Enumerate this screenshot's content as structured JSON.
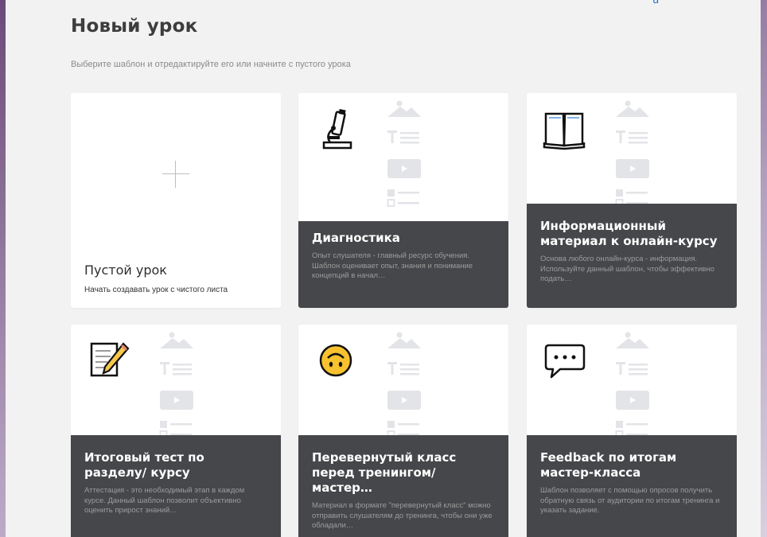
{
  "header": {
    "top_link": "u",
    "title": "Новый урок",
    "subtitle": "Выберите шаблон и отредактируйте его или начните с пустого урока"
  },
  "blank": {
    "title": "Пустой урок",
    "desc": "Начать создавать урок с чистого листа"
  },
  "templates": [
    {
      "title": "Диагностика",
      "desc": "Опыт слушателя - главный ресурс обучения. Шаблон оценивает опыт, знания и понимание концепций в начал…",
      "icon": "microscope-icon"
    },
    {
      "title": "Информационный материал к онлайн-курсу",
      "desc": "Основа любого онлайн-курса - информация. Используйте данный шаблон, чтобы эффективно подать…",
      "icon": "book-icon"
    },
    {
      "title": "Итоговый тест по разделу/ курсу",
      "desc": "Аттестация - это необходимый этап в каждом курсе. Данный шаблон позволит объективно оценить прирост знаний…",
      "icon": "memo-pencil-icon"
    },
    {
      "title": "Перевернутый класс перед тренингом/мастер…",
      "desc": "Материал в формате \"перевернутый класс\" можно отправить слушателям до тренинга, чтобы они уже обладали…",
      "icon": "upside-down-face-icon"
    },
    {
      "title": "Feedback по итогам мастер-класса",
      "desc": "Шаблон позволяет с помощью опросов получить обратную связь от аудитории по итогам тренинга и указать задание.",
      "icon": "speech-bubble-icon"
    }
  ],
  "colors": {
    "panel_bg": "#f2f2f2",
    "card_bg": "#ffffff",
    "dark_bg": "#45474a",
    "placeholder": "#e3e4e8"
  }
}
